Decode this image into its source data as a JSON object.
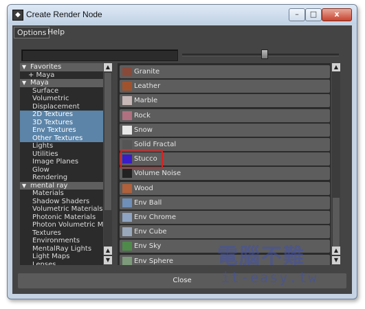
{
  "window": {
    "title": "Create Render Node"
  },
  "menu": {
    "options": "Options",
    "help": "Help"
  },
  "tree": [
    {
      "label": "Favorites",
      "kind": "header"
    },
    {
      "label": "+ Maya",
      "kind": "sub"
    },
    {
      "label": "Maya",
      "kind": "header"
    },
    {
      "label": "Surface",
      "kind": "item"
    },
    {
      "label": "Volumetric",
      "kind": "item"
    },
    {
      "label": "Displacement",
      "kind": "item"
    },
    {
      "label": "2D Textures",
      "kind": "item",
      "selected": true
    },
    {
      "label": "3D Textures",
      "kind": "item",
      "selected": true
    },
    {
      "label": "Env Textures",
      "kind": "item",
      "selected": true
    },
    {
      "label": "Other Textures",
      "kind": "item",
      "selected": true
    },
    {
      "label": "Lights",
      "kind": "item"
    },
    {
      "label": "Utilities",
      "kind": "item"
    },
    {
      "label": "Image Planes",
      "kind": "item"
    },
    {
      "label": "Glow",
      "kind": "item"
    },
    {
      "label": "Rendering",
      "kind": "item"
    },
    {
      "label": "mental ray",
      "kind": "header"
    },
    {
      "label": "Materials",
      "kind": "item"
    },
    {
      "label": "Shadow Shaders",
      "kind": "item"
    },
    {
      "label": "Volumetric Materials",
      "kind": "item"
    },
    {
      "label": "Photonic Materials",
      "kind": "item"
    },
    {
      "label": "Photon Volumetric Ma...",
      "kind": "item"
    },
    {
      "label": "Textures",
      "kind": "item"
    },
    {
      "label": "Environments",
      "kind": "item"
    },
    {
      "label": "MentalRay Lights",
      "kind": "item"
    },
    {
      "label": "Light Maps",
      "kind": "item"
    },
    {
      "label": "Lenses",
      "kind": "item"
    }
  ],
  "nodes": [
    {
      "label": "Granite",
      "color": "#8a4a3a"
    },
    {
      "label": "Leather",
      "color": "#a0522d"
    },
    {
      "label": "Marble",
      "color": "#c8b8b8"
    },
    {
      "label": "Rock",
      "color": "#b07080"
    },
    {
      "label": "Snow",
      "color": "#e8e8e8"
    },
    {
      "label": "Solid Fractal",
      "color": "#555555"
    },
    {
      "label": "Stucco",
      "color": "#3a1cc8"
    },
    {
      "label": "Volume Noise",
      "color": "#222222"
    },
    {
      "label": "Wood",
      "color": "#b0603a"
    },
    {
      "label": "Env Ball",
      "color": "#6f8fb8"
    },
    {
      "label": "Env Chrome",
      "color": "#8fa4c2"
    },
    {
      "label": "Env Cube",
      "color": "#9aa8bc"
    },
    {
      "label": "Env Sky",
      "color": "#4f8a4a"
    },
    {
      "label": "Env Sphere",
      "color": "#7d9a7a"
    }
  ],
  "buttons": {
    "close": "Close"
  },
  "caption": {
    "minimize": "–",
    "maximize": "□",
    "close": "x"
  },
  "watermark": {
    "cn": "電腦不難",
    "en": "it-easy.tw"
  },
  "icons": {
    "app": "maya-icon",
    "scroll_up": "arrow-up-icon",
    "scroll_down": "arrow-down-icon"
  }
}
